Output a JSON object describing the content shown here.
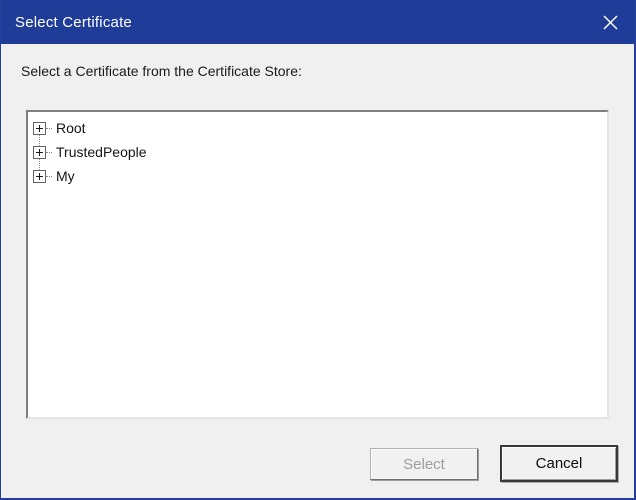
{
  "window": {
    "title": "Select Certificate"
  },
  "colors": {
    "titlebar-bg": "#1e3c98",
    "window-border": "#24409a",
    "dialog-bg": "#f0f0f0",
    "tree-bg": "#ffffff"
  },
  "icons": {
    "close": "✕",
    "expand": "+"
  },
  "body": {
    "store_label": "Select a Certificate from the Certificate Store:"
  },
  "tree": {
    "items": [
      {
        "label": "Root",
        "state": "collapsed"
      },
      {
        "label": "TrustedPeople",
        "state": "collapsed"
      },
      {
        "label": "My",
        "state": "collapsed"
      }
    ]
  },
  "buttons": {
    "select": {
      "label": "Select",
      "enabled": false
    },
    "cancel": {
      "label": "Cancel",
      "enabled": true,
      "default": true
    }
  }
}
